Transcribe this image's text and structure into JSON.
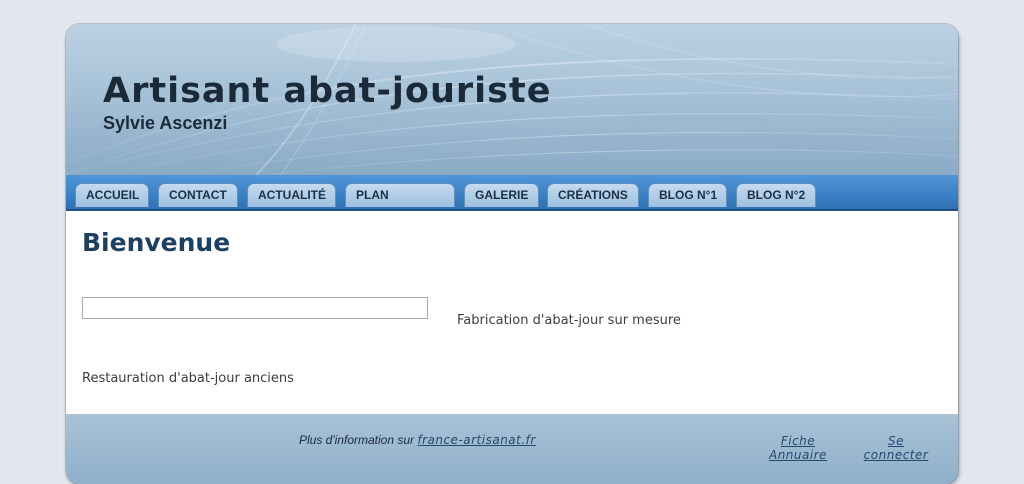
{
  "header": {
    "title": "Artisant abat-jouriste",
    "subtitle": "Sylvie Ascenzi"
  },
  "nav": {
    "items": [
      {
        "label": "ACCUEIL"
      },
      {
        "label": "CONTACT"
      },
      {
        "label": "ACTUALITÉ"
      },
      {
        "label": "PLAN"
      },
      {
        "label": "GALERIE"
      },
      {
        "label": "CRÉATIONS"
      },
      {
        "label": "BLOG N°1"
      },
      {
        "label": "BLOG N°2"
      }
    ]
  },
  "main": {
    "heading": "Bienvenue",
    "line1": "Fabrication d'abat-jour sur mesure",
    "line2": "Restauration d'abat-jour anciens"
  },
  "footer": {
    "info_prefix": "Plus d'information sur ",
    "info_link": "france-artisanat.fr",
    "fiche_line1": "Fiche",
    "fiche_line2": "Annuaire",
    "connect_line1": "Se",
    "connect_line2": "connecter"
  },
  "colors": {
    "nav_blue": "#3a80c4",
    "heading_blue": "#1e4060",
    "page_bg": "#e2e7ee"
  }
}
